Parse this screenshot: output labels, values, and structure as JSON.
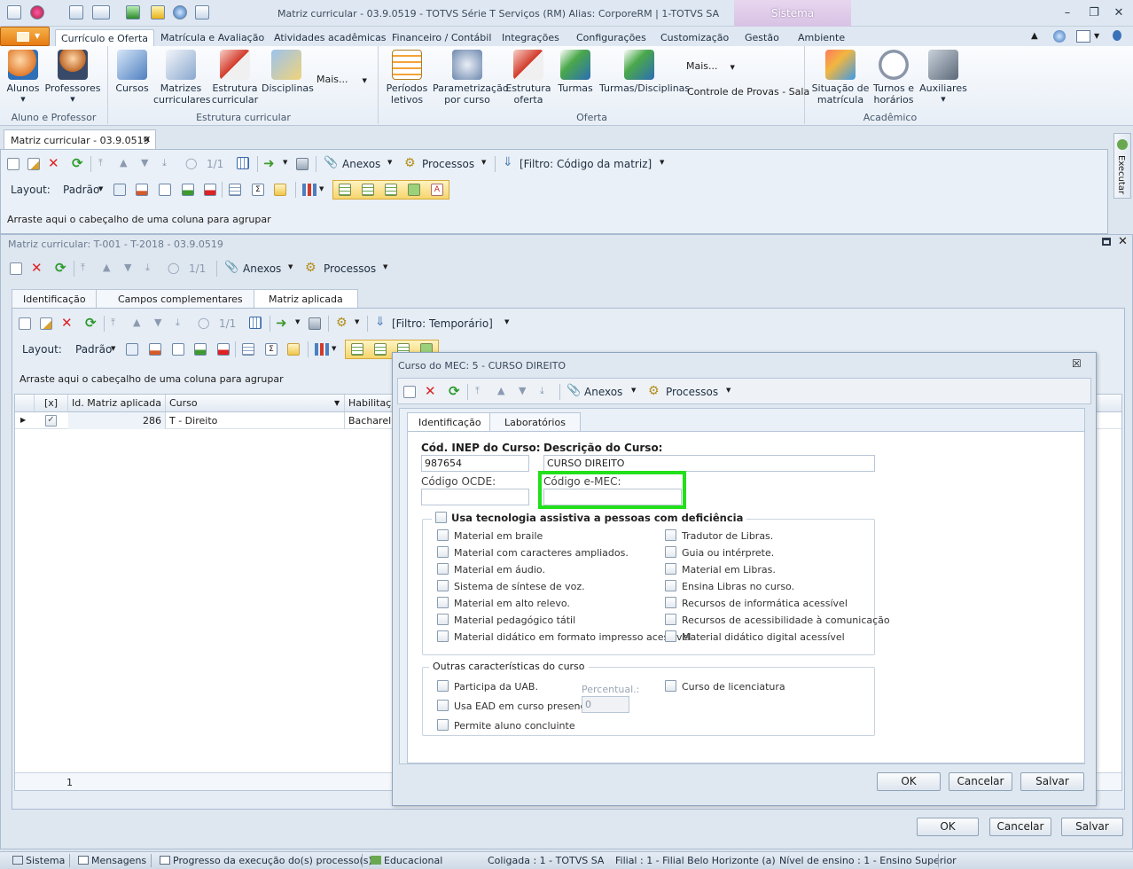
{
  "window": {
    "title": "Matriz curricular - 03.9.0519 - TOTVS Série T Serviços (RM) Alias: CorporeRM | 1-TOTVS SA",
    "context_tab": "Sistema"
  },
  "ribbon_tabs": [
    "Currículo e Oferta",
    "Matrícula e Avaliação",
    "Atividades acadêmicas",
    "Financeiro / Contábil",
    "Integrações",
    "Configurações",
    "Customização",
    "Gestão",
    "Ambiente"
  ],
  "ribbon": {
    "groups": {
      "aluno_professor": "Aluno e Professor",
      "estrutura": "Estrutura curricular",
      "oferta": "Oferta",
      "academico": "Acadêmico"
    },
    "buttons": {
      "alunos": "Alunos",
      "professores": "Professores",
      "cursos": "Cursos",
      "matrizes_1": "Matrizes",
      "matrizes_2": "curriculares",
      "estrutura_1": "Estrutura",
      "estrutura_2": "curricular",
      "disciplinas": "Disciplinas",
      "mais": "Mais...",
      "periodos_1": "Períodos",
      "periodos_2": "letivos",
      "param_1": "Parametrização",
      "param_2": "por curso",
      "estoferta_1": "Estrutura",
      "estoferta_2": "oferta",
      "turmas": "Turmas",
      "turmas_disc": "Turmas/Disciplinas",
      "mais2": "Mais...",
      "controle": "Controle de Provas - Sala",
      "situacao_1": "Situação de",
      "situacao_2": "matrícula",
      "turnos_1": "Turnos e",
      "turnos_2": "horários",
      "auxiliares": "Auxiliares"
    }
  },
  "doc_tab": "Matriz curricular - 03.9.0519",
  "outer_panel": {
    "toolbar": {
      "counter": "1/1",
      "anexos": "Anexos",
      "processos": "Processos",
      "filtro": "[Filtro: Código da matriz]"
    },
    "layout": {
      "label": "Layout:",
      "preset": "Padrão"
    },
    "group_hint": "Arraste aqui o cabeçalho de uma coluna para agrupar",
    "execute": "Executar"
  },
  "matriz_form": {
    "title": "Matriz curricular: T-001 - T-2018 - 03.9.0519",
    "toolbar": {
      "counter": "1/1",
      "anexos": "Anexos",
      "processos": "Processos"
    },
    "tabs": [
      "Identificação",
      "Campos complementares",
      "Matriz aplicada"
    ],
    "inner_toolbar": {
      "counter": "1/1",
      "filtro": "[Filtro: Temporário]"
    },
    "layout": {
      "label": "Layout:",
      "preset": "Padrão"
    },
    "group_hint": "Arraste aqui o cabeçalho de uma coluna para agrupar",
    "columns": [
      "[x]",
      "Id. Matriz aplicada",
      "Curso",
      "Habilitação"
    ],
    "rows": [
      {
        "id": "286",
        "curso": "T - Direito",
        "habilitacao": "Bacharel em"
      }
    ],
    "footer_count": "1",
    "buttons": {
      "ok": "OK",
      "cancelar": "Cancelar",
      "salvar": "Salvar"
    }
  },
  "dialog": {
    "title": "Curso do MEC: 5 - CURSO DIREITO",
    "toolbar": {
      "anexos": "Anexos",
      "processos": "Processos"
    },
    "tabs": [
      "Identificação",
      "Laboratórios"
    ],
    "fields": {
      "inep_label": "Cód. INEP do Curso:",
      "inep_value": "987654",
      "descricao_label": "Descrição do Curso:",
      "descricao_value": "CURSO DIREITO",
      "ocde_label": "Código OCDE:",
      "ocde_value": "",
      "emec_label": "Código e-MEC:",
      "emec_value": ""
    },
    "assistiva": {
      "title": "Usa tecnologia assistiva a pessoas com deficiência",
      "left": [
        "Material em braile",
        "Material com caracteres ampliados.",
        "Material em áudio.",
        "Sistema de síntese de voz.",
        "Material em alto relevo.",
        "Material pedagógico tátil",
        "Material didático em formato impresso acessível"
      ],
      "right": [
        "Tradutor de Libras.",
        "Guia ou intérprete.",
        "Material em Libras.",
        "Ensina Libras no curso.",
        "Recursos de informática acessível",
        "Recursos de acessibilidade à comunicação",
        "Material didático digital acessível"
      ]
    },
    "outras": {
      "title": "Outras características do curso",
      "uab": "Participa da UAB.",
      "ead": "Usa EAD em curso presencial.",
      "concluinte": "Permite aluno concluinte",
      "licenciatura": "Curso de licenciatura",
      "percentual_label": "Percentual.:",
      "percentual_value": "0"
    },
    "buttons": {
      "ok": "OK",
      "cancelar": "Cancelar",
      "salvar": "Salvar"
    },
    "highlight_color": "#22e01a"
  },
  "statusbar": {
    "sistema": "Sistema",
    "mensagens": "Mensagens",
    "progresso": "Progresso da execução do(s) processo(s)",
    "educacional": "Educacional",
    "coligada": "Coligada : 1 - TOTVS SA",
    "filial": "Filial : 1 - Filial Belo Horizonte (a)",
    "nivel": "Nível de ensino : 1 - Ensino Superior"
  }
}
